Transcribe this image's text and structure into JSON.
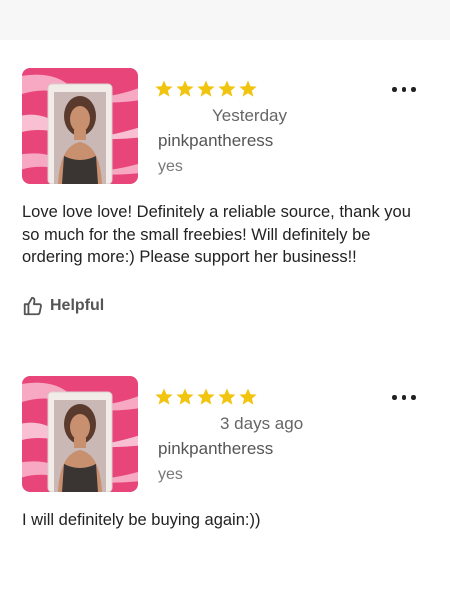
{
  "colors": {
    "star": "#f1c40f",
    "text": "#222222",
    "muted": "#666666",
    "background": "#ffffff"
  },
  "reviews": [
    {
      "rating": 5,
      "date": "Yesterday",
      "username": "pinkpantheress",
      "variant": "yes",
      "text": "Love love love! Definitely a reliable source, thank you so much for the small freebies! Will definitely be ordering more:) Please support her business!!",
      "helpful_label": "Helpful",
      "icons": {
        "star": "star-icon",
        "more": "more-options-icon",
        "helpful": "thumbs-up-icon"
      }
    },
    {
      "rating": 5,
      "date": "3 days ago",
      "username": "pinkpantheress",
      "variant": "yes",
      "text": "I will definitely be buying again:))",
      "icons": {
        "star": "star-icon",
        "more": "more-options-icon"
      }
    }
  ]
}
